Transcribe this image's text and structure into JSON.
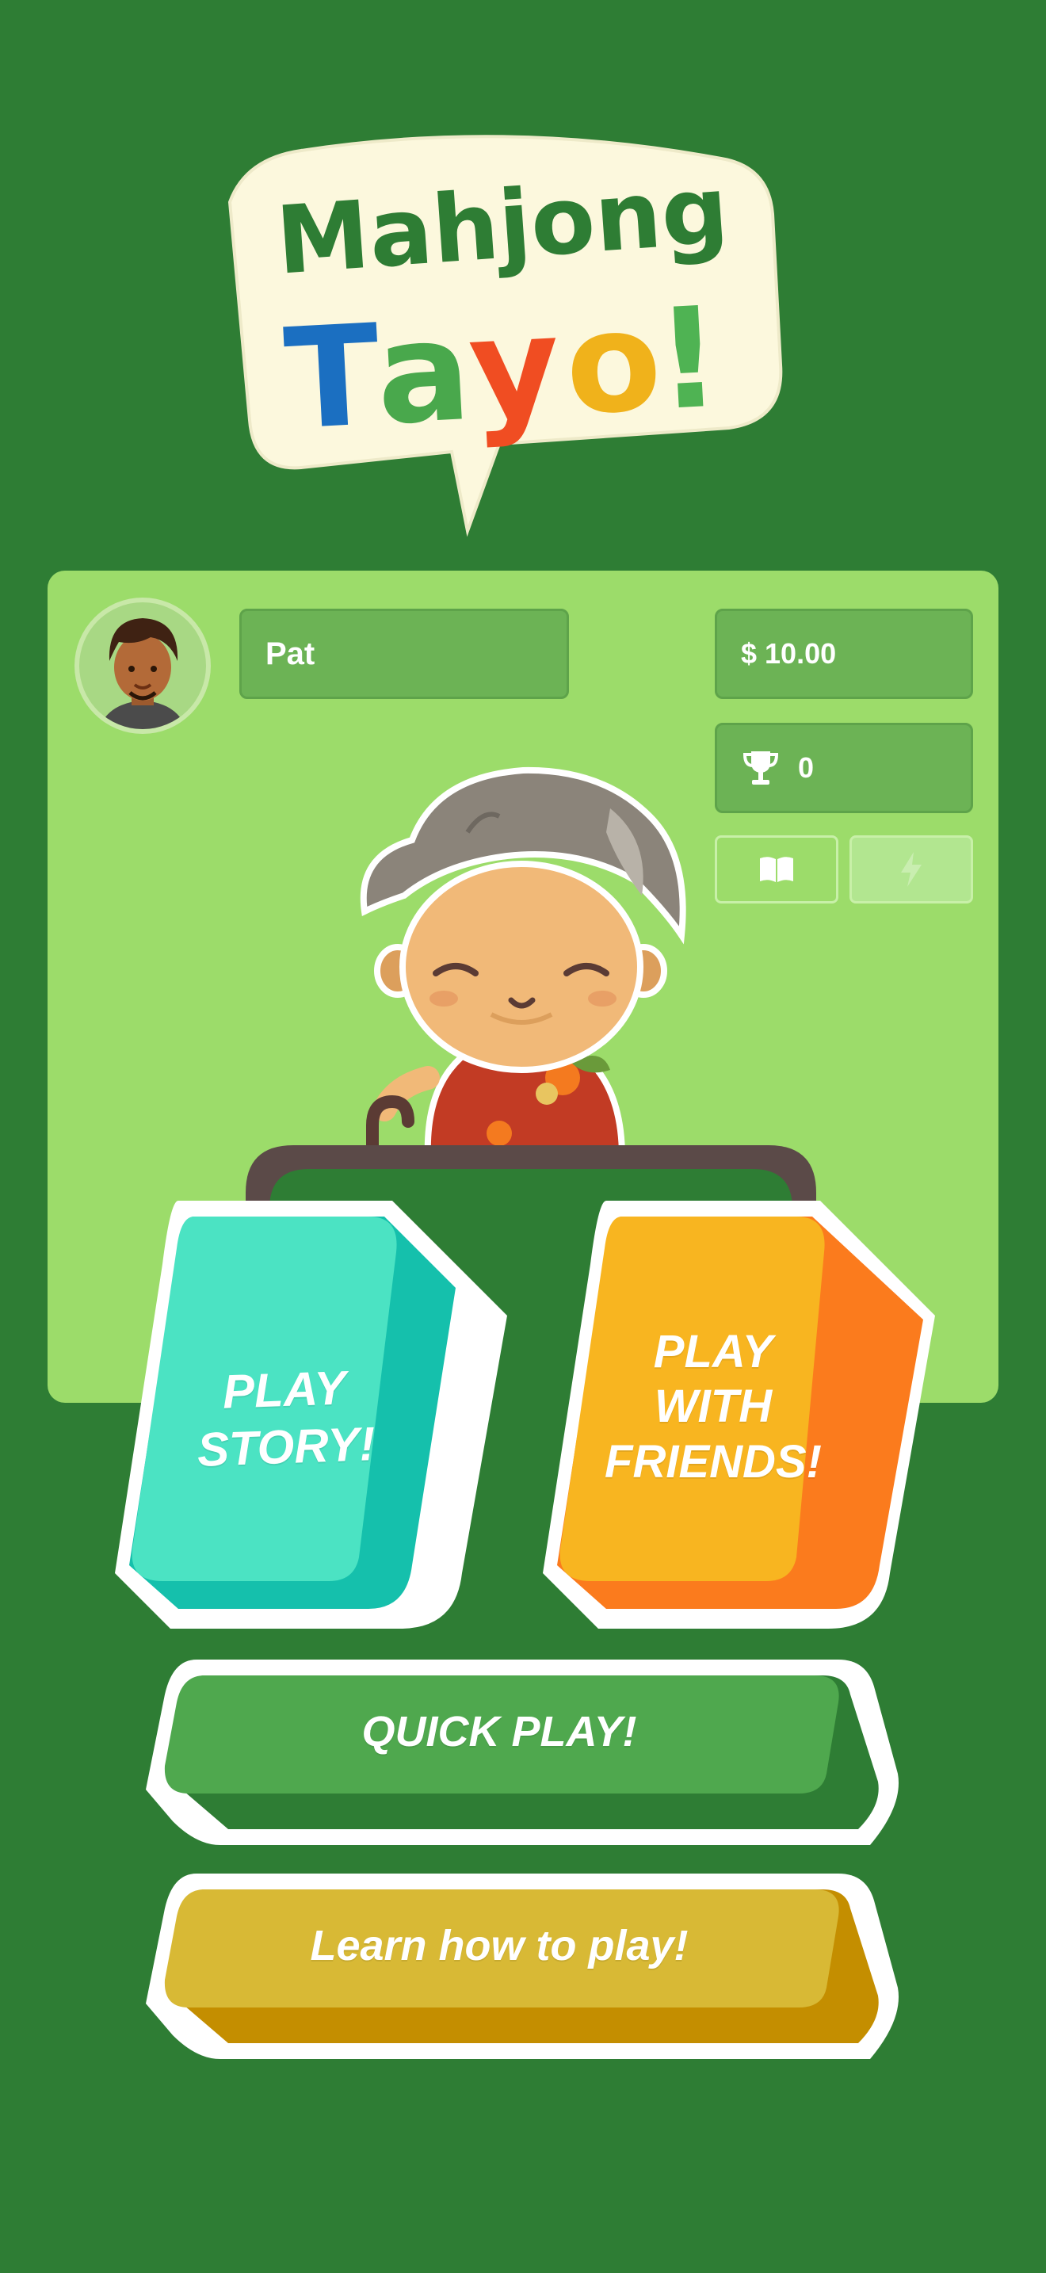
{
  "logo": {
    "line1": "Mahjong",
    "line2_letters": [
      "T",
      "a",
      "y",
      "o",
      "!"
    ],
    "line2_colors": [
      "#1b6fc1",
      "#49a84c",
      "#f04d22",
      "#f0b21b",
      "#4fb353"
    ]
  },
  "player": {
    "name": "Pat",
    "money": "$ 10.00",
    "trophies": "0"
  },
  "icons": {
    "trophy": "trophy-icon",
    "book": "book-icon",
    "bolt": "lightning-icon"
  },
  "buttons": {
    "play_story": "PLAY\nSTORY!",
    "play_friends": "PLAY\nWITH\nFRIENDS!",
    "quick_play": "QUICK PLAY!",
    "learn": "Learn how to play!"
  },
  "colors": {
    "background": "#2e7d34",
    "panel": "#9cdc6a",
    "story": "#4be3c3",
    "friends": "#f8b520",
    "quick": "#4fa84e",
    "learn": "#d8b935"
  }
}
